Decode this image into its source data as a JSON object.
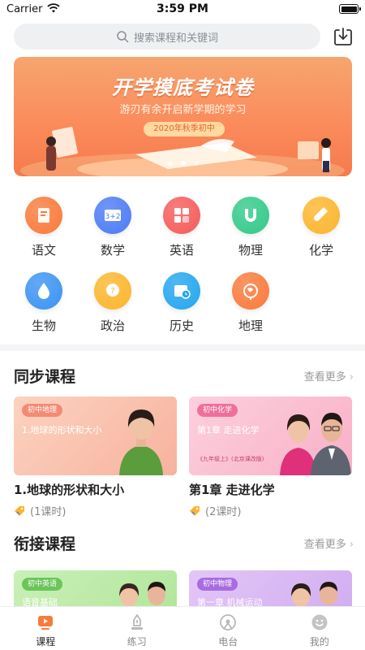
{
  "status_bar": {
    "carrier": "Carrier",
    "time": "3:59 PM"
  },
  "search": {
    "placeholder": "搜索课程和关键词"
  },
  "banner": {
    "title": "开学摸底考试卷",
    "subtitle": "游刃有余开启新学期的学习",
    "tag": "2020年秋季初中",
    "slide_count": 3,
    "active_slide": 2
  },
  "subjects": [
    {
      "label": "语文",
      "icon": "book-icon",
      "color": "#f97a3b"
    },
    {
      "label": "数学",
      "icon": "math-icon",
      "color": "#4c7bf5"
    },
    {
      "label": "英语",
      "icon": "abc-icon",
      "color": "#f65b5b"
    },
    {
      "label": "物理",
      "icon": "magnet-icon",
      "color": "#33c98a"
    },
    {
      "label": "化学",
      "icon": "test-tube-icon",
      "color": "#fbb52c"
    },
    {
      "label": "生物",
      "icon": "water-drop-icon",
      "color": "#3b93f3"
    },
    {
      "label": "政治",
      "icon": "politics-icon",
      "color": "#fbb52c"
    },
    {
      "label": "历史",
      "icon": "calendar-clock-icon",
      "color": "#23a6f0"
    },
    {
      "label": "地理",
      "icon": "globe-icon",
      "color": "#f97a3b"
    }
  ],
  "sync_section": {
    "title": "同步课程",
    "more": "查看更多",
    "courses": [
      {
        "badge": "初中地理",
        "thumb_text": "1.地球的形状和大小",
        "title": "1.地球的形状和大小",
        "meta": "(1课时)"
      },
      {
        "badge": "初中化学",
        "thumb_text": "第1章 走进化学",
        "thumb_note": "《九年级上》(北京课改版)",
        "title": "第1章 走进化学",
        "meta": "(2课时)"
      }
    ]
  },
  "bridge_section": {
    "title": "衔接课程",
    "more": "查看更多",
    "courses": [
      {
        "badge": "初中英语",
        "thumb_text": "语音基础"
      },
      {
        "badge": "初中物理",
        "thumb_text": "第一章 机械运动"
      }
    ]
  },
  "tab_bar": {
    "tabs": [
      {
        "label": "课程",
        "icon": "course-play-icon",
        "active": true
      },
      {
        "label": "练习",
        "icon": "pen-icon",
        "active": false
      },
      {
        "label": "电台",
        "icon": "radio-icon",
        "active": false
      },
      {
        "label": "我的",
        "icon": "smile-icon",
        "active": false
      }
    ]
  },
  "colors": {
    "accent": "#f97a3b",
    "banner": "#fb8c5c",
    "text": "#222222",
    "muted": "#999999"
  }
}
